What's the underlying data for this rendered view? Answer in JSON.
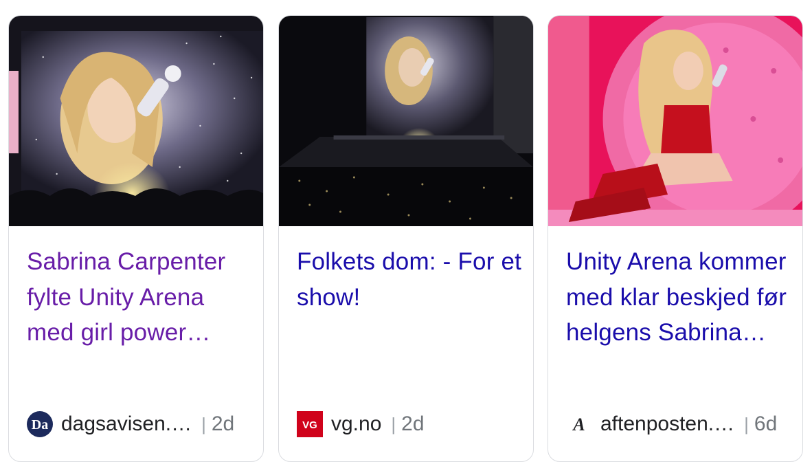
{
  "cards": [
    {
      "title": "Sabrina Carpenter fylte Unity Arena med girl power…",
      "source": "dagsavisen.…",
      "age": "2d",
      "logo_text": "Da",
      "image": "concert-screen-closeup"
    },
    {
      "title": "Folkets dom: - For et show!",
      "source": "vg.no",
      "age": "2d",
      "logo_text": "VG",
      "image": "arena-stage-wide"
    },
    {
      "title": "Unity Arena kommer med klar beskjed før helgens Sabrina…",
      "source": "aftenposten.…",
      "age": "6d",
      "logo_text": "A",
      "image": "singer-pink-heart-set"
    }
  ],
  "colors": {
    "visited_link": "#681da8",
    "link": "#1a0dab",
    "vg_red": "#d0021b",
    "dagsavisen_navy": "#1c2a5c"
  }
}
